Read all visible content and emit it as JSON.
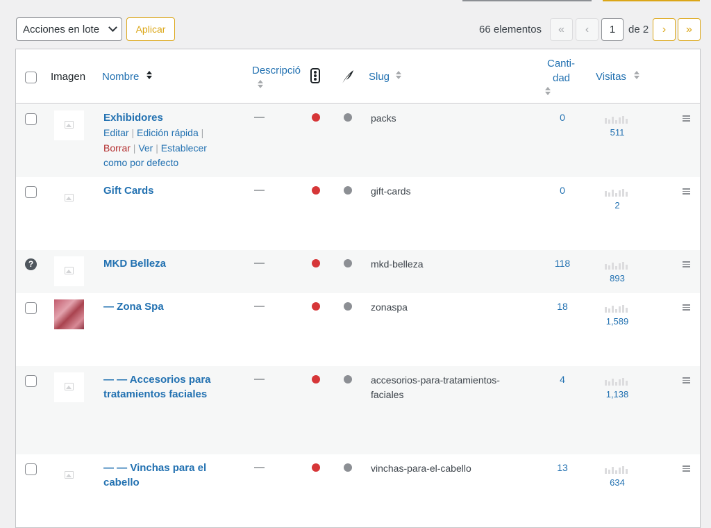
{
  "toolbar": {
    "bulk_actions": "Acciones en lote",
    "apply": "Aplicar"
  },
  "pagination": {
    "count": "66 elementos",
    "first": "«",
    "prev": "‹",
    "current": "1",
    "of": "de 2",
    "next": "›",
    "last": "»"
  },
  "headers": {
    "image": "Imagen",
    "name": "Nombre",
    "description": "Descripción",
    "slug": "Slug",
    "quantity_line1": "Canti-",
    "quantity_line2": "dad",
    "visits": "Visitas"
  },
  "row_actions": {
    "edit": "Editar",
    "quick_edit": "Edición rápida",
    "delete": "Borrar",
    "view": "Ver",
    "set_default": "Establecer como por defecto"
  },
  "rows": [
    {
      "name": "Exhibidores",
      "description": "—",
      "slug": "packs",
      "quantity": "0",
      "visits": "511"
    },
    {
      "name": "Gift Cards",
      "description": "—",
      "slug": "gift-cards",
      "quantity": "0",
      "visits": "2"
    },
    {
      "name": "MKD Belleza",
      "description": "—",
      "slug": "mkd-belleza",
      "quantity": "118",
      "visits": "893"
    },
    {
      "name": "— Zona Spa",
      "description": "—",
      "slug": "zonaspa",
      "quantity": "18",
      "visits": "1,589"
    },
    {
      "name": "— — Accesorios para tratamientos faciales",
      "description": "—",
      "slug": "accesorios-para-tratamientos-faciales",
      "quantity": "4",
      "visits": "1,138"
    },
    {
      "name": "— — Vinchas para el cabello",
      "description": "—",
      "slug": "vinchas-para-el-cabello",
      "quantity": "13",
      "visits": "634"
    }
  ],
  "colors": {
    "link": "#2271b1",
    "accent": "#dba617",
    "status_red": "#d63638",
    "status_gray": "#8c8f94",
    "delete": "#b32d2e"
  }
}
